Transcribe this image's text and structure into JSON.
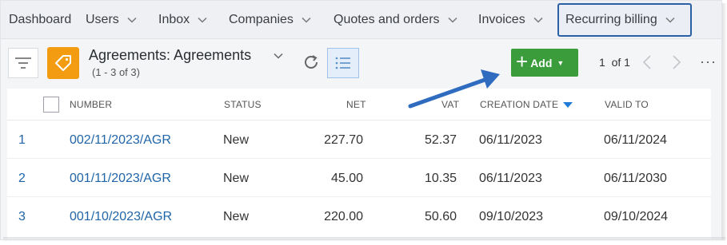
{
  "nav": {
    "items": [
      {
        "label": "Dashboard",
        "has_menu": false
      },
      {
        "label": "Users",
        "has_menu": true
      },
      {
        "label": "Inbox",
        "has_menu": true
      },
      {
        "label": "Companies",
        "has_menu": true
      },
      {
        "label": "Quotes and orders",
        "has_menu": true
      },
      {
        "label": "Invoices",
        "has_menu": true
      },
      {
        "label": "Recurring billing",
        "has_menu": true,
        "active": true
      }
    ]
  },
  "toolbar": {
    "title": "Agreements: Agreements",
    "subtitle": "(1 - 3 of 3)",
    "add_label": "Add",
    "paging": "1  of 1",
    "more": "···"
  },
  "table": {
    "columns": [
      "NUMBER",
      "STATUS",
      "NET",
      "VAT",
      "CREATION DATE",
      "VALID TO"
    ],
    "sorted_column": "CREATION DATE",
    "sort_direction": "desc",
    "rows": [
      {
        "index": "1",
        "number": "002/11/2023/AGR",
        "status": "New",
        "net": "227.70",
        "vat": "52.37",
        "creation_date": "06/11/2023",
        "valid_to": "06/11/2024"
      },
      {
        "index": "2",
        "number": "001/11/2023/AGR",
        "status": "New",
        "net": "45.00",
        "vat": "10.35",
        "creation_date": "06/11/2023",
        "valid_to": "06/11/2030"
      },
      {
        "index": "3",
        "number": "001/10/2023/AGR",
        "status": "New",
        "net": "220.00",
        "vat": "50.60",
        "creation_date": "09/10/2023",
        "valid_to": "09/10/2024"
      }
    ]
  },
  "colors": {
    "accent": "#2b5fa6",
    "add_button": "#3b9c3c",
    "agreements_icon": "#f39c12",
    "link": "#2165a8",
    "annotation_arrow": "#2f6cc0"
  },
  "icons": {
    "filter": "filter-lines-icon",
    "agreements": "tag-icon",
    "refresh": "refresh-icon",
    "list_view": "list-view-icon",
    "prev": "chevron-left-icon",
    "next": "chevron-right-icon",
    "more": "ellipsis-icon"
  }
}
